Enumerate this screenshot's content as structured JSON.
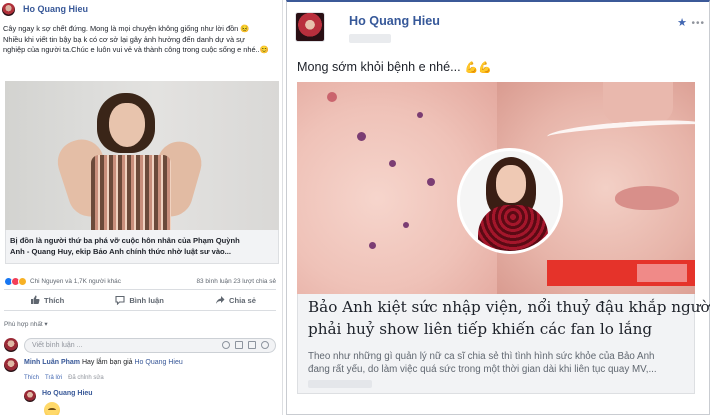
{
  "left_post": {
    "author": "Ho Quang Hieu",
    "text_lines": [
      "Cây ngay k sợ chết đứng. Mong là mọi chuyện không giống như lời đồn 😣",
      "Nhiều khi viết tin bậy bạ k có cơ sở lại gây ảnh hưởng đến danh dự và sự",
      "nghiệp của người ta.Chúc e luôn vui vẻ và thành công trong cuộc sống e nhé..😊"
    ],
    "link_caption_lines": [
      "Bị đồn là người thứ ba phá vỡ cuộc hôn nhân của Phạm Quỳnh",
      "Anh - Quang Huy, ekip Bảo Anh chính thức nhờ luật sư vào..."
    ],
    "reactions_text": "Chi Nguyen và 1,7K người khác",
    "counts_text": "83 bình luận   23 lượt chia sẻ",
    "actions": {
      "like": "Thích",
      "comment": "Bình luận",
      "share": "Chia sẻ"
    },
    "sort_label": "Phù hợp nhất ▾",
    "comment_placeholder": "Viết bình luận ...",
    "comment": {
      "user": "Minh Luân Pham",
      "text": "Hay lắm bạn giả",
      "tag": "Ho Quang Hieu"
    },
    "comment_meta": {
      "like": "Thích",
      "reply": "Trả lời",
      "edited": "Đã chỉnh sửa"
    },
    "reply_user": "Ho Quang Hieu"
  },
  "right_post": {
    "author": "Ho Quang Hieu",
    "message": "Mong sớm khỏi bệnh e nhé...",
    "message_emoji": "💪💪",
    "headline_lines": [
      "Bảo Anh kiệt sức nhập viện, nổi thuỷ đậu khắp người",
      "phải huỷ show liên tiếp khiến các fan lo lắng"
    ],
    "description_lines": [
      "Theo như những gì quản lý nữ ca sĩ chia sẻ thì tình hình sức khỏe của Bảo Anh",
      "đang rất yếu, do làm việc quá sức trong một thời gian dài khi liên tục quay MV,..."
    ]
  },
  "colors": {
    "link": "#385898",
    "fb_blue": "#4267b2",
    "muted": "#606770",
    "caption_bg": "#f2f3f5"
  },
  "icons": [
    "avatar",
    "like-icon",
    "comment-icon",
    "share-icon",
    "star-icon",
    "more-icon",
    "emoji-icon",
    "camera-icon",
    "gif-icon",
    "sticker-icon"
  ]
}
